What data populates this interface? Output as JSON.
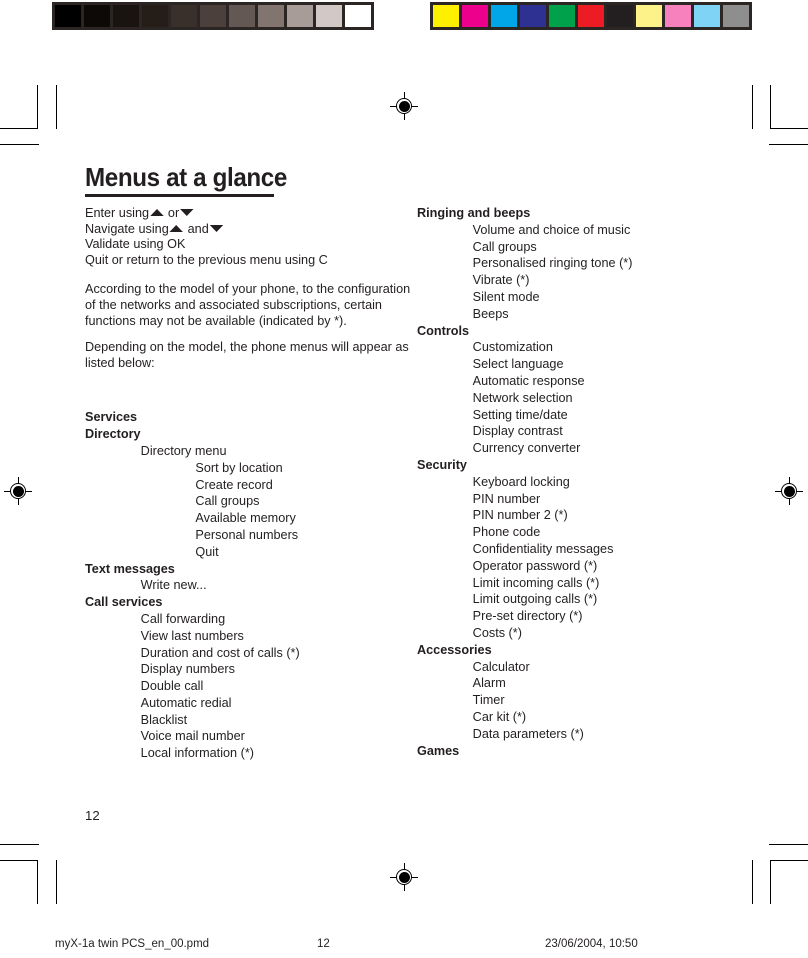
{
  "document": {
    "title": "Menus at a glance",
    "page_number": "12"
  },
  "calibration": {
    "grayscale_label": "grayscale-step-wedge",
    "grayscale_patches": [
      "#000000",
      "#0c0907",
      "#19140f",
      "#241d18",
      "#3a302b",
      "#4b403c",
      "#635854",
      "#82756f",
      "#a89c98",
      "#d2c8c5",
      "#ffffff"
    ],
    "color_label": "color-control-bar",
    "color_patches": [
      "#fff000",
      "#ec008c",
      "#00a6e8",
      "#2e3192",
      "#00a14b",
      "#ed1c24",
      "#231f20",
      "#fdf18a",
      "#f681bd",
      "#7fd4f5",
      "#8e8e8e"
    ]
  },
  "intro": {
    "keys_line_1_before": "Enter using",
    "keys_line_1_mid": "or",
    "keys_line_2_before": "Navigate using",
    "keys_line_2_mid": "and",
    "keys_line_3": "Validate using OK",
    "keys_line_4": "Quit or return to the previous menu using C",
    "paragraph_1": "According to the model of your phone, to the configuration of the networks and associated subscriptions, certain functions may not be available (indicated by *).",
    "paragraph_2": "Depending on the model, the phone menus will appear as listed below:"
  },
  "menu_left": [
    {
      "level": 0,
      "label": "Services"
    },
    {
      "level": 0,
      "label": "Directory"
    },
    {
      "level": 1,
      "label": "Directory menu"
    },
    {
      "level": 2,
      "label": "Sort by location"
    },
    {
      "level": 2,
      "label": "Create record"
    },
    {
      "level": 2,
      "label": "Call groups"
    },
    {
      "level": 2,
      "label": "Available memory"
    },
    {
      "level": 2,
      "label": "Personal numbers"
    },
    {
      "level": 2,
      "label": "Quit"
    },
    {
      "level": 0,
      "label": "Text messages"
    },
    {
      "level": 1,
      "label": "Write new..."
    },
    {
      "level": 0,
      "label": "Call services"
    },
    {
      "level": 1,
      "label": "Call forwarding"
    },
    {
      "level": 1,
      "label": "View last numbers"
    },
    {
      "level": 1,
      "label": "Duration and cost of calls (*)"
    },
    {
      "level": 1,
      "label": "Display numbers"
    },
    {
      "level": 1,
      "label": "Double call"
    },
    {
      "level": 1,
      "label": "Automatic redial"
    },
    {
      "level": 1,
      "label": "Blacklist"
    },
    {
      "level": 1,
      "label": "Voice mail number"
    },
    {
      "level": 1,
      "label": "Local information (*)"
    }
  ],
  "menu_right": [
    {
      "level": 0,
      "label": "Ringing and beeps"
    },
    {
      "level": 1,
      "label": "Volume and choice of music"
    },
    {
      "level": 1,
      "label": "Call groups"
    },
    {
      "level": 1,
      "label": "Personalised ringing tone (*)"
    },
    {
      "level": 1,
      "label": "Vibrate (*)"
    },
    {
      "level": 1,
      "label": "Silent mode"
    },
    {
      "level": 1,
      "label": "Beeps"
    },
    {
      "level": 0,
      "label": "Controls"
    },
    {
      "level": 1,
      "label": "Customization"
    },
    {
      "level": 1,
      "label": "Select language"
    },
    {
      "level": 1,
      "label": "Automatic response"
    },
    {
      "level": 1,
      "label": "Network selection"
    },
    {
      "level": 1,
      "label": "Setting time/date"
    },
    {
      "level": 1,
      "label": "Display contrast"
    },
    {
      "level": 1,
      "label": "Currency converter"
    },
    {
      "level": 0,
      "label": "Security"
    },
    {
      "level": 1,
      "label": "Keyboard locking"
    },
    {
      "level": 1,
      "label": "PIN number"
    },
    {
      "level": 1,
      "label": "PIN number 2 (*)"
    },
    {
      "level": 1,
      "label": "Phone code"
    },
    {
      "level": 1,
      "label": "Confidentiality messages"
    },
    {
      "level": 1,
      "label": "Operator password (*)"
    },
    {
      "level": 1,
      "label": "Limit incoming calls (*)"
    },
    {
      "level": 1,
      "label": "Limit outgoing calls (*)"
    },
    {
      "level": 1,
      "label": "Pre-set directory (*)"
    },
    {
      "level": 1,
      "label": "Costs (*)"
    },
    {
      "level": 0,
      "label": "Accessories"
    },
    {
      "level": 1,
      "label": "Calculator"
    },
    {
      "level": 1,
      "label": "Alarm"
    },
    {
      "level": 1,
      "label": "Timer"
    },
    {
      "level": 1,
      "label": "Car kit (*)"
    },
    {
      "level": 1,
      "label": "Data parameters (*)"
    },
    {
      "level": 0,
      "label": "Games"
    }
  ],
  "print_footer": {
    "filename": "myX-1a twin PCS_en_00.pmd",
    "page": "12",
    "timestamp": "23/06/2004, 10:50"
  }
}
